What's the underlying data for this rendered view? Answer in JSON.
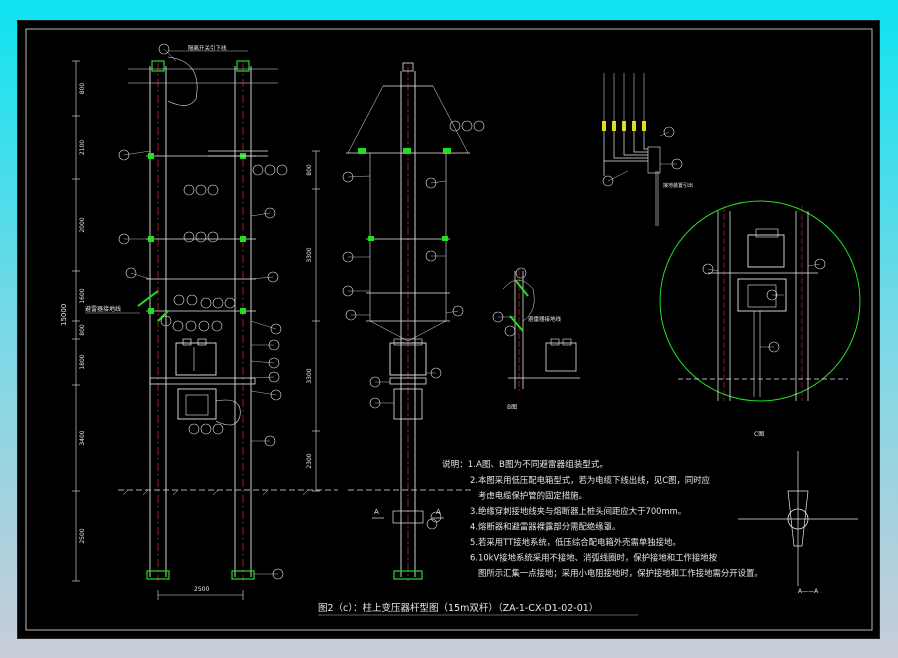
{
  "colors": {
    "background": "#000000",
    "linework": "#e8e8e8",
    "pole_outline": "#ffffff",
    "pole_center": "#ff3030",
    "accent": "#22dd22",
    "callout": "#e8e8e8"
  },
  "dimensions_left": [
    "800",
    "2100",
    "2000",
    "1600",
    "800",
    "1800",
    "3400",
    "2500"
  ],
  "dimension_total": "15000",
  "dimension_bottom": "2500",
  "dimensions_middle": [
    "800",
    "3300",
    "3300",
    "2300"
  ],
  "labels": {
    "guard_wire_left": "避雷器接地线",
    "guard_wire_right": "避雷器接地线",
    "top_note": "隔离开关引下线",
    "cable_note": "接地装置引出"
  },
  "section_marks": {
    "a": "A",
    "b": "B图",
    "c": "C图"
  },
  "notes": {
    "heading": "说明：1.A图、B图为不同避雷器组装型式。",
    "lines": [
      "2.本图采用低压配电箱型式，若为电缆下线出线，见C图，同时应",
      "考虑电缆保护管的固定措施。",
      "3.绝缘穿刺接地线夹与熔断器上桩头间距应大于700mm。",
      "4.熔断器和避雷器裸露部分需配绝缘罩。",
      "5.若采用TT接地系统，低压综合配电箱外壳需单独接地。",
      "6.10kV接地系统采用不接地、消弧线圈时，保护接地和工作接地按",
      "图所示汇集一点接地；采用小电阻接地时，保护接地和工作接地需分开设置。"
    ]
  },
  "caption": "图2（c）：柱上变压器杆型图（15m双杆）（ZA-1-CX-D1-02-01）",
  "section_symbol": "A——A"
}
